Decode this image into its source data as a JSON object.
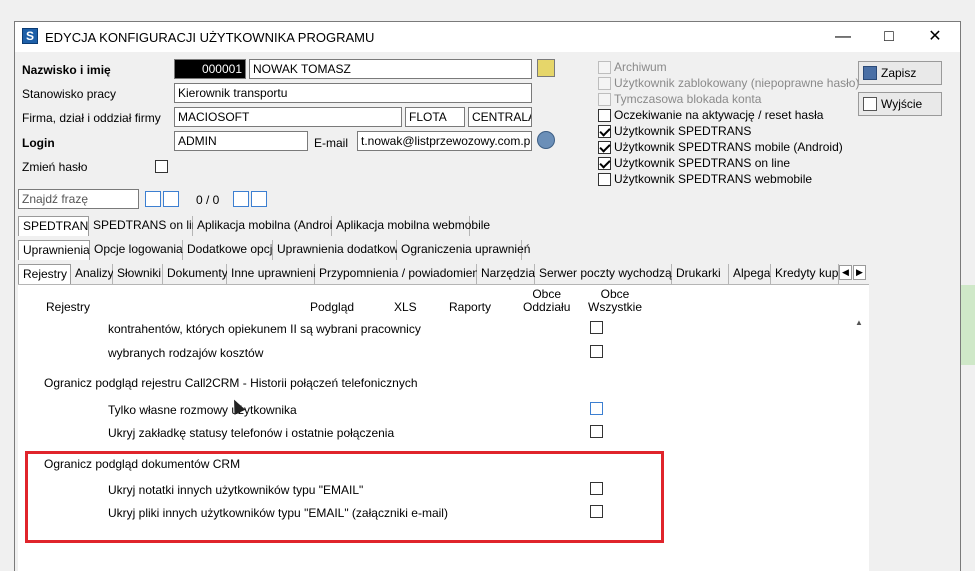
{
  "window": {
    "title": "EDYCJA KONFIGURACJI UŻYTKOWNIKA PROGRAMU",
    "logo_letter": "S"
  },
  "form": {
    "name_label": "Nazwisko i imię",
    "code": "000001",
    "name": "NOWAK TOMASZ",
    "position_label": "Stanowisko pracy",
    "position": "Kierownik transportu",
    "company_label": "Firma, dział i oddział firmy",
    "company": "MACIOSOFT",
    "department": "FLOTA",
    "branch": "CENTRALA",
    "login_label": "Login",
    "login": "ADMIN",
    "email_label": "E-mail",
    "email": "t.nowak@listprzewozowy.com.pl",
    "change_password_label": "Zmień hasło"
  },
  "status_options": [
    {
      "label": "Archiwum",
      "checked": false,
      "disabled": true
    },
    {
      "label": "Użytkownik zablokowany (niepoprawne hasło)",
      "checked": false,
      "disabled": true
    },
    {
      "label": "Tymczasowa blokada konta",
      "checked": false,
      "disabled": true
    },
    {
      "label": "Oczekiwanie na aktywację / reset hasła",
      "checked": false,
      "disabled": false
    },
    {
      "label": "Użytkownik SPEDTRANS",
      "checked": true,
      "disabled": false
    },
    {
      "label": "Użytkownik SPEDTRANS mobile (Android)",
      "checked": true,
      "disabled": false
    },
    {
      "label": "Użytkownik SPEDTRANS on line",
      "checked": true,
      "disabled": false
    },
    {
      "label": "Użytkownik SPEDTRANS webmobile",
      "checked": false,
      "disabled": false
    }
  ],
  "buttons": {
    "save": "Zapisz",
    "exit": "Wyjście"
  },
  "search": {
    "placeholder": "Znajdź frazę",
    "counter": "0 / 0"
  },
  "tabs_level1": [
    "SPEDTRANS",
    "SPEDTRANS on line",
    "Aplikacja mobilna (Android)",
    "Aplikacja mobilna webmobile"
  ],
  "tabs_level2": [
    "Uprawnienia",
    "Opcje logowania",
    "Dodatkowe opcje",
    "Uprawnienia dodatkowe",
    "Ograniczenia uprawnień"
  ],
  "tabs_level3": [
    "Rejestry",
    "Analizy",
    "Słowniki",
    "Dokumenty",
    "Inne uprawnienia",
    "Przypomnienia / powiadomienia",
    "Narzędzia",
    "Serwer poczty wychodzącej",
    "Drukarki",
    "Alpega",
    "Kredyty kup"
  ],
  "columns": {
    "rejestry": "Rejestry",
    "podglad": "Podgląd",
    "xls": "XLS",
    "raporty": "Raporty",
    "obce_oddzialu": "Obce\nOddziału",
    "obce_wszystkie": "Obce\nWszystkie"
  },
  "rows": [
    {
      "text": "kontrahentów, których opiekunem II są wybrani pracownicy",
      "type": "item",
      "checked": false
    },
    {
      "text": "wybranych rodzajów kosztów",
      "type": "item",
      "checked": false
    },
    {
      "text": "Ogranicz podgląd rejestru Call2CRM - Historii połączeń telefonicznych",
      "type": "group"
    },
    {
      "text": "Tylko własne rozmowy użytkownika",
      "type": "item",
      "checked": false
    },
    {
      "text": "Ukryj zakładkę statusy telefonów i ostatnie połączenia",
      "type": "item",
      "checked": false
    },
    {
      "text": "Ogranicz podgląd dokumentów CRM",
      "type": "group"
    },
    {
      "text": "Ukryj notatki innych użytkowników typu \"EMAIL\"",
      "type": "item",
      "checked": false
    },
    {
      "text": "Ukryj pliki innych użytkowników typu \"EMAIL\" (załączniki e-mail)",
      "type": "item",
      "checked": false
    }
  ],
  "colors": {
    "highlight_box": "#e0242b",
    "dark_field": "#000000"
  }
}
